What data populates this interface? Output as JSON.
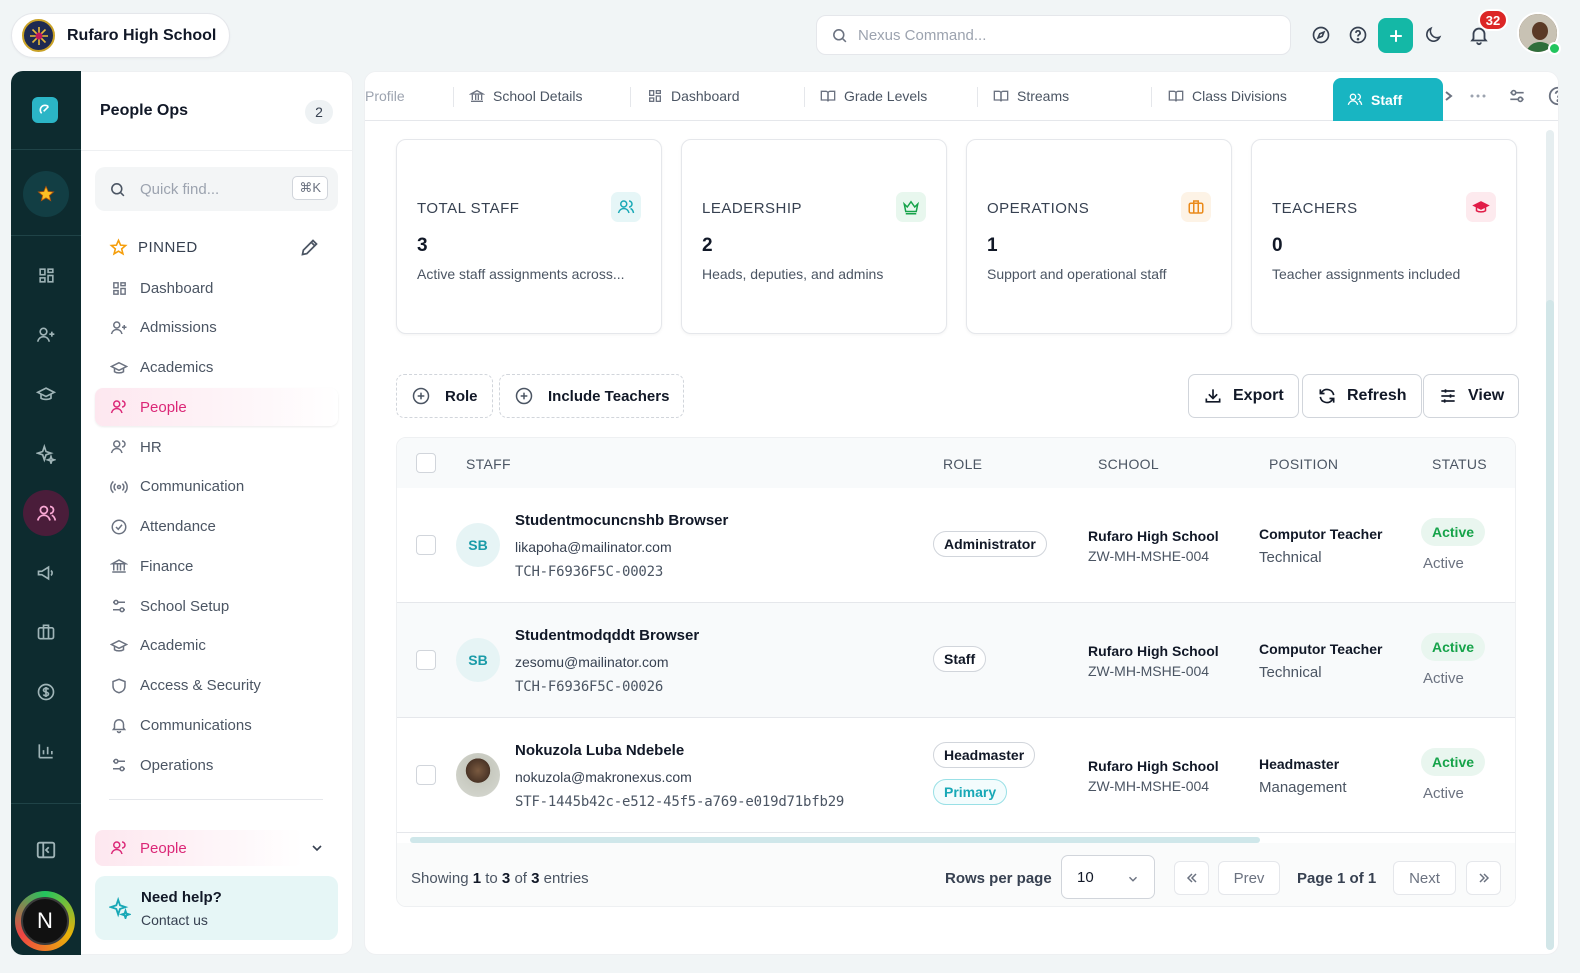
{
  "header": {
    "school_name": "Rufaro High School",
    "search_placeholder": "Nexus Command...",
    "notification_count": "32"
  },
  "rail": {
    "items": [
      "star-icon",
      "grid-icon",
      "user-plus-icon",
      "graduation-icon",
      "sparkle-icon",
      "users-icon",
      "megaphone-icon",
      "briefcase-icon",
      "dollar-icon",
      "chart-icon"
    ],
    "active": "users-icon",
    "avatar_letter": "N"
  },
  "sidebar": {
    "title": "People Ops",
    "count": "2",
    "quick_placeholder": "Quick find...",
    "quick_shortcut": "⌘K",
    "pinned_label": "PINNED",
    "items": [
      {
        "label": "Dashboard",
        "icon": "grid-icon"
      },
      {
        "label": "Admissions",
        "icon": "user-plus-icon"
      },
      {
        "label": "Academics",
        "icon": "graduation-icon"
      },
      {
        "label": "People",
        "icon": "users-icon",
        "active": true
      },
      {
        "label": "HR",
        "icon": "users-icon"
      },
      {
        "label": "Communication",
        "icon": "broadcast-icon"
      },
      {
        "label": "Attendance",
        "icon": "check-circle-icon"
      },
      {
        "label": "Finance",
        "icon": "bank-icon"
      },
      {
        "label": "School Setup",
        "icon": "sliders-icon"
      },
      {
        "label": "Academic",
        "icon": "graduation-icon"
      },
      {
        "label": "Access & Security",
        "icon": "shield-icon"
      },
      {
        "label": "Communications",
        "icon": "bell-icon"
      },
      {
        "label": "Operations",
        "icon": "sliders-icon"
      }
    ],
    "section_label": "People",
    "help_title": "Need help?",
    "help_subtitle": "Contact us"
  },
  "tabs": [
    {
      "label": "Profile"
    },
    {
      "label": "School Details"
    },
    {
      "label": "Dashboard"
    },
    {
      "label": "Grade Levels"
    },
    {
      "label": "Streams"
    },
    {
      "label": "Class Divisions"
    },
    {
      "label": "Staff",
      "active": true
    }
  ],
  "stats": [
    {
      "label": "TOTAL STAFF",
      "value": "3",
      "desc": "Active staff assignments across...",
      "icon": "users-icon",
      "color": "#18a8b6"
    },
    {
      "label": "LEADERSHIP",
      "value": "2",
      "desc": "Heads, deputies, and admins",
      "icon": "crown-icon",
      "color": "#16a34a"
    },
    {
      "label": "OPERATIONS",
      "value": "1",
      "desc": "Support and operational staff",
      "icon": "briefcase-icon",
      "color": "#ea8a1a"
    },
    {
      "label": "TEACHERS",
      "value": "0",
      "desc": "Teacher assignments included",
      "icon": "graduation-icon",
      "color": "#e11d48"
    }
  ],
  "filters": {
    "role": "Role",
    "include_teachers": "Include Teachers"
  },
  "actions": {
    "export": "Export",
    "refresh": "Refresh",
    "view": "View"
  },
  "table": {
    "columns": {
      "staff": "STAFF",
      "role": "ROLE",
      "school": "SCHOOL",
      "position": "POSITION",
      "status": "STATUS"
    },
    "rows": [
      {
        "initials": "SB",
        "name": "Studentmocuncnshb Browser",
        "email": "likapoha@mailinator.com",
        "code": "TCH-F6936F5C-00023",
        "roles": [
          "Administrator"
        ],
        "school": "Rufaro High School",
        "school_id": "ZW-MH-MSHE-004",
        "position": "Computor Teacher",
        "department": "Technical",
        "status": "Active",
        "status_text": "Active"
      },
      {
        "initials": "SB",
        "name": "Studentmodqddt Browser",
        "email": "zesomu@mailinator.com",
        "code": "TCH-F6936F5C-00026",
        "roles": [
          "Staff"
        ],
        "school": "Rufaro High School",
        "school_id": "ZW-MH-MSHE-004",
        "position": "Computor Teacher",
        "department": "Technical",
        "status": "Active",
        "status_text": "Active"
      },
      {
        "initials": "",
        "photo": true,
        "name": "Nokuzola Luba Ndebele",
        "email": "nokuzola@makronexus.com",
        "code": "STF-1445b42c-e512-45f5-a769-e019d71bfb29",
        "roles": [
          "Headmaster",
          "Primary"
        ],
        "school": "Rufaro High School",
        "school_id": "ZW-MH-MSHE-004",
        "position": "Headmaster",
        "department": "Management",
        "status": "Active",
        "status_text": "Active"
      }
    ]
  },
  "pagination": {
    "showing_prefix": "Showing",
    "from": "1",
    "to_word": "to",
    "to": "3",
    "of_word": "of",
    "total": "3",
    "suffix": "entries",
    "rows_per_page_label": "Rows per page",
    "rows_per_page": "10",
    "prev": "Prev",
    "next": "Next",
    "page_label": "Page 1 of 1"
  }
}
